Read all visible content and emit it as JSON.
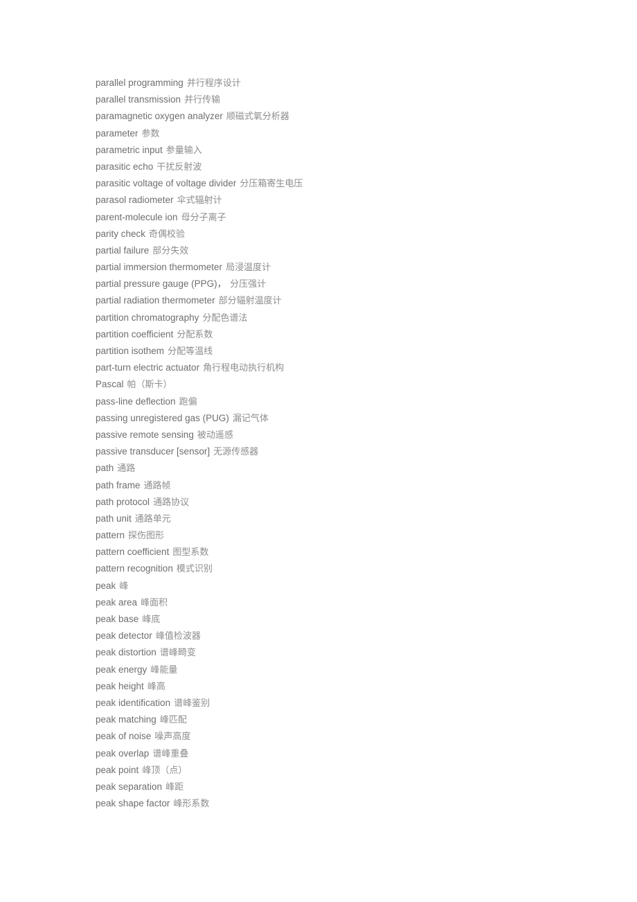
{
  "page": {
    "background_color": "#ffffff",
    "term_color": "#6e6e6e",
    "gloss_color": "#8d8d8d",
    "entry_count": 44
  },
  "glossary": {
    "entries": [
      {
        "term": "parallel programming",
        "gloss": "并行程序设计"
      },
      {
        "term": "parallel transmission",
        "gloss": "并行传输"
      },
      {
        "term": "paramagnetic oxygen analyzer",
        "gloss": "顺磁式氧分析器"
      },
      {
        "term": "parameter",
        "gloss": "参数"
      },
      {
        "term": "parametric input",
        "gloss": "参量输入"
      },
      {
        "term": "parasitic echo",
        "gloss": "干扰反射波"
      },
      {
        "term": "parasitic voltage of voltage divider",
        "gloss": "分压箱寄生电压"
      },
      {
        "term": "parasol radiometer",
        "gloss": "伞式辐射计"
      },
      {
        "term": "parent-molecule ion",
        "gloss": "母分子离子"
      },
      {
        "term": "parity check",
        "gloss": "奇偶校验"
      },
      {
        "term": "partial failure",
        "gloss": "部分失效"
      },
      {
        "term": "partial immersion thermometer",
        "gloss": "局浸温度计"
      },
      {
        "term": "partial pressure gauge (PPG)，",
        "gloss": "分压强计"
      },
      {
        "term": "partial radiation thermometer",
        "gloss": "部分辐射温度计"
      },
      {
        "term": "partition chromatography",
        "gloss": "分配色谱法"
      },
      {
        "term": "partition coefficient",
        "gloss": "分配系数"
      },
      {
        "term": "partition isothem",
        "gloss": "分配等温线"
      },
      {
        "term": "part-turn electric actuator",
        "gloss": "角行程电动执行机构"
      },
      {
        "term": "Pascal",
        "gloss": "帕（斯卡）"
      },
      {
        "term": "pass-line deflection",
        "gloss": "跑偏"
      },
      {
        "term": "passing unregistered gas (PUG)",
        "gloss": "漏记气体"
      },
      {
        "term": "passive remote sensing",
        "gloss": "被动遥感"
      },
      {
        "term": "passive transducer [sensor]",
        "gloss": "无源传感器"
      },
      {
        "term": "path",
        "gloss": "通路"
      },
      {
        "term": "path frame",
        "gloss": "通路帧"
      },
      {
        "term": "path protocol",
        "gloss": "通路协议"
      },
      {
        "term": "path unit",
        "gloss": "通路单元"
      },
      {
        "term": "pattern",
        "gloss": "探伤图形"
      },
      {
        "term": "pattern coefficient",
        "gloss": "图型系数"
      },
      {
        "term": "pattern recognition",
        "gloss": "模式识别"
      },
      {
        "term": "peak",
        "gloss": "峰"
      },
      {
        "term": "peak area",
        "gloss": "峰面积"
      },
      {
        "term": "peak base",
        "gloss": "峰底"
      },
      {
        "term": "peak detector",
        "gloss": "峰值检波器"
      },
      {
        "term": "peak distortion",
        "gloss": "谱峰畸变"
      },
      {
        "term": "peak energy",
        "gloss": "峰能量"
      },
      {
        "term": "peak height",
        "gloss": "峰高"
      },
      {
        "term": "peak identification",
        "gloss": "谱峰鉴别"
      },
      {
        "term": "peak matching",
        "gloss": "峰匹配"
      },
      {
        "term": "peak of noise",
        "gloss": "噪声高度"
      },
      {
        "term": "peak overlap",
        "gloss": "谱峰重叠"
      },
      {
        "term": "peak point",
        "gloss": "峰顶（点）"
      },
      {
        "term": "peak separation",
        "gloss": "峰距"
      },
      {
        "term": "peak shape factor",
        "gloss": "峰形系数"
      }
    ]
  }
}
